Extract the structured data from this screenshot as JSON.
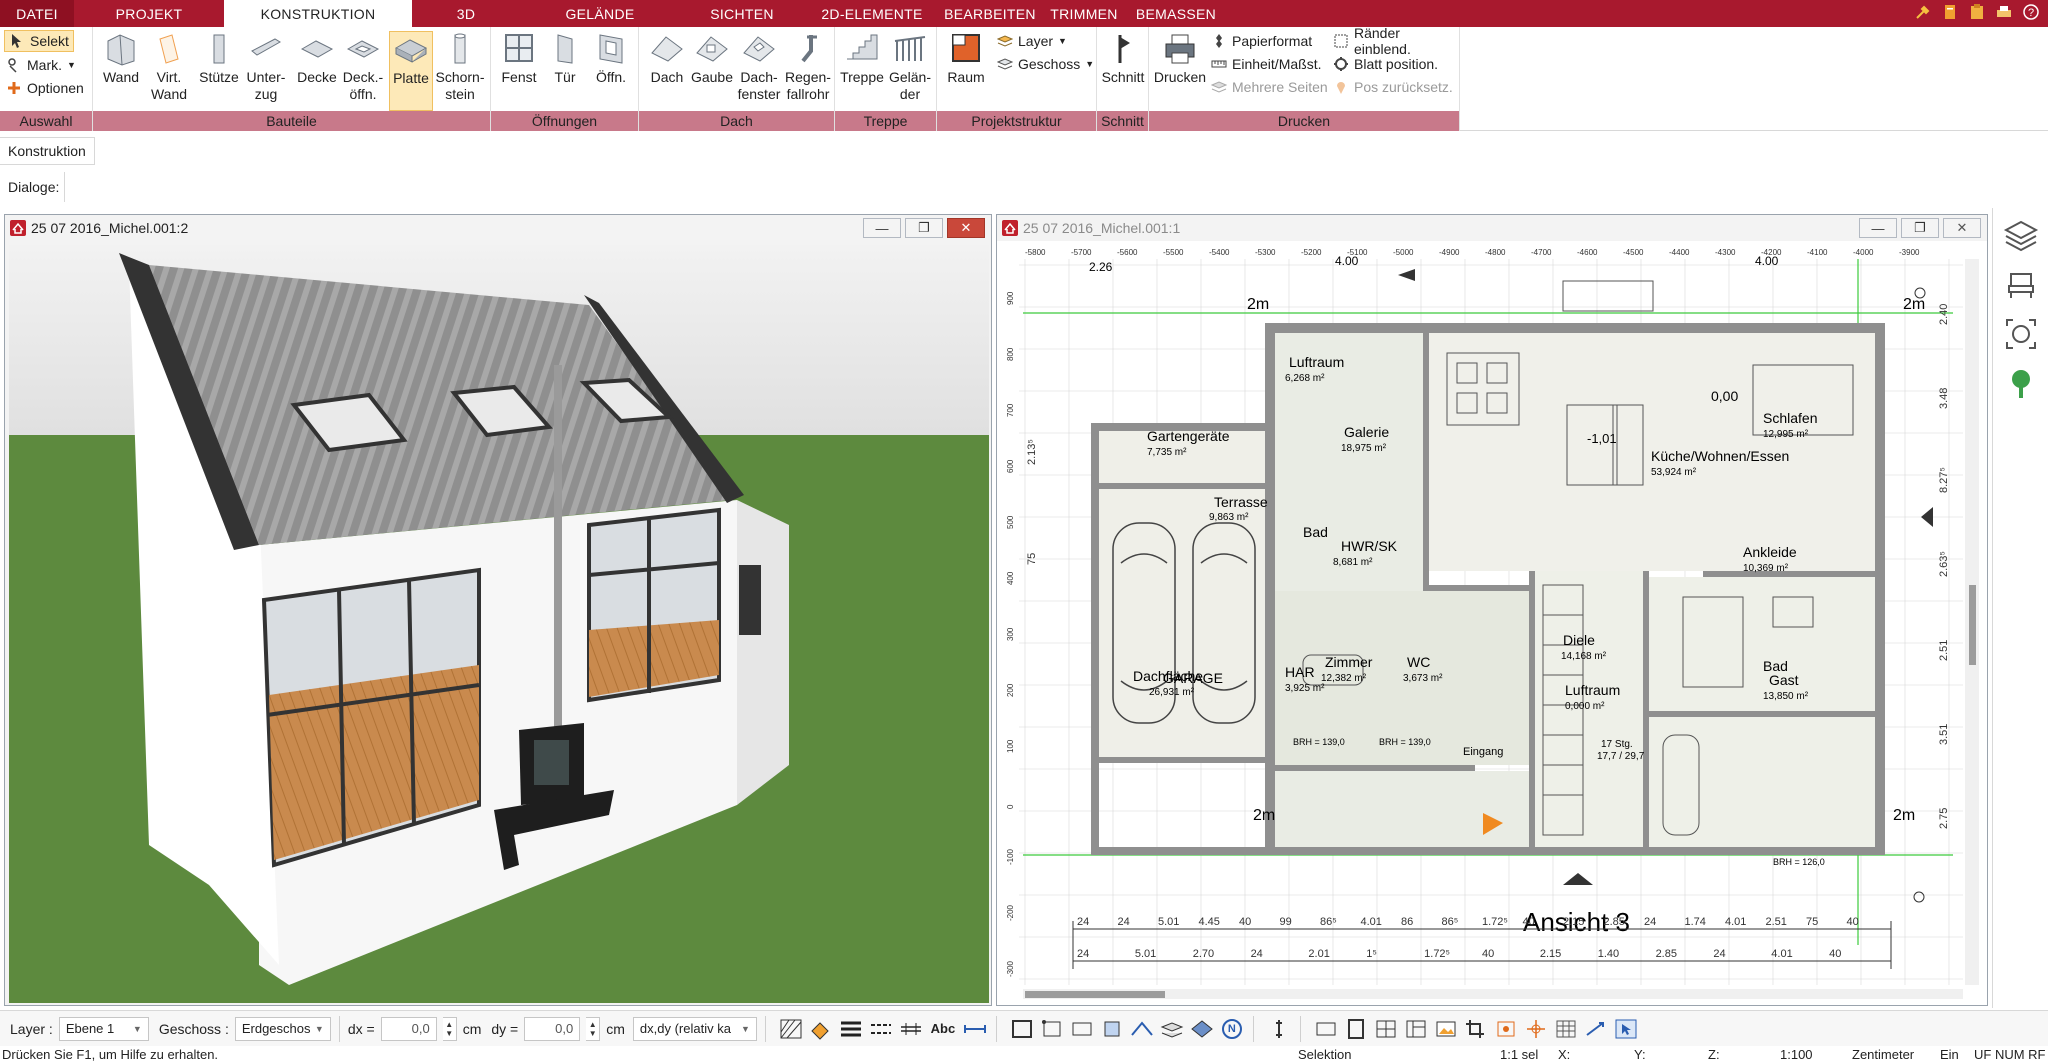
{
  "tabs": [
    {
      "label": "DATEI"
    },
    {
      "label": "PROJEKT"
    },
    {
      "label": "KONSTRUKTION"
    },
    {
      "label": "3D"
    },
    {
      "label": "GELÄNDE"
    },
    {
      "label": "SICHTEN"
    },
    {
      "label": "2D-ELEMENTE"
    },
    {
      "label": "BEARBEITEN"
    },
    {
      "label": "TRIMMEN"
    },
    {
      "label": "BEMASSEN"
    }
  ],
  "ribbon": {
    "auswahl": {
      "label": "Auswahl",
      "selekt": "Selekt",
      "mark": "Mark.",
      "optionen": "Optionen"
    },
    "bauteile": {
      "label": "Bauteile",
      "wand": "Wand",
      "virt_wand_1": "Virt.",
      "virt_wand_2": "Wand",
      "stuetze": "Stütze",
      "unterzug_1": "Unter-",
      "unterzug_2": "zug",
      "decke": "Decke",
      "deck_oeffn_1": "Deck.-",
      "deck_oeffn_2": "öffn.",
      "platte": "Platte",
      "schornstein_1": "Schorn-",
      "schornstein_2": "stein"
    },
    "oeffnungen": {
      "label": "Öffnungen",
      "fenst": "Fenst",
      "tuer": "Tür",
      "oeffn": "Öffn."
    },
    "dach": {
      "label": "Dach",
      "dach": "Dach",
      "gaube": "Gaube",
      "dachfenster_1": "Dach-",
      "dachfenster_2": "fenster",
      "regenfallrohr_1": "Regen-",
      "regenfallrohr_2": "fallrohr"
    },
    "treppe": {
      "label": "Treppe",
      "treppe": "Treppe",
      "gelaender_1": "Gelän-",
      "gelaender_2": "der"
    },
    "projektstruktur": {
      "label": "Projektstruktur",
      "raum": "Raum",
      "layer": "Layer",
      "geschoss": "Geschoss"
    },
    "schnitt": {
      "label": "Schnitt",
      "schnitt": "Schnitt"
    },
    "drucken": {
      "label": "Drucken",
      "drucken": "Drucken",
      "papierformat": "Papierformat",
      "einheit": "Einheit/Maßst.",
      "mehrere_seiten": "Mehrere Seiten",
      "raender": "Ränder einblend.",
      "blatt_position": "Blatt position.",
      "pos_zurueck": "Pos zurücksetz."
    }
  },
  "subtab": "Konstruktion",
  "dialog_label": "Dialoge:",
  "windows": {
    "view3d_title": "25 07 2016_Michel.001:2",
    "plan_title": "25 07 2016_Michel.001:1"
  },
  "plan": {
    "rooms": [
      {
        "name": "Luftraum",
        "area": "6,268 m²"
      },
      {
        "name": "Galerie",
        "area": "18,975 m²"
      },
      {
        "name": "Gartengeräte",
        "area": "7,735 m²"
      },
      {
        "name": "Terrasse",
        "area": "9,863 m²"
      },
      {
        "name": "Schlafen",
        "area": "12,995 m²"
      },
      {
        "name": "Küche/Wohnen/Essen",
        "area": "53,924 m²"
      },
      {
        "name": "Bad",
        "area": ""
      },
      {
        "name": "HWR/SK",
        "area": "8,681 m²"
      },
      {
        "name": "Ankleide",
        "area": "10,369 m²"
      },
      {
        "name": "Diele",
        "area": "14,168 m²"
      },
      {
        "name": "HAR",
        "area": "3,925 m²"
      },
      {
        "name": "Zimmer",
        "area": "12,382 m²"
      },
      {
        "name": "WC",
        "area": "3,673 m²"
      },
      {
        "name": "Bad",
        "area": "13,850 m²"
      },
      {
        "name": "Gast",
        "area": ""
      },
      {
        "name": "Dachfläche",
        "area": "26,931 m²"
      },
      {
        "name": "GARAGE",
        "area": ""
      },
      {
        "name": "Luftraum",
        "area": "0,000 m²"
      },
      {
        "name": "Eingang",
        "area": ""
      }
    ],
    "labels": {
      "ansicht": "Ansicht 3",
      "two_m_1": "2m",
      "two_m_2": "2m",
      "two_m_3": "2m",
      "two_m_4": "2m",
      "zero": "0,00",
      "minus_one": "-1,01",
      "brh_bottom": "BRH = 126,0",
      "stg": "17 Stg.",
      "stg_val": "17,7 / 29,7",
      "dim_226": "2.26",
      "dim_400a": "4.00",
      "dim_400b": "4.00",
      "brh_139a": "BRH = 139,0",
      "brh_139b": "BRH = 139,0"
    },
    "ruler_top": [
      "-5800",
      "-5700",
      "-5600",
      "-5500",
      "-5400",
      "-5300",
      "-5200",
      "-5100",
      "-5000",
      "-4900",
      "-4800",
      "-4700",
      "-4600",
      "-4500",
      "-4400",
      "-4300",
      "-4200",
      "-4100",
      "-4000",
      "-3900"
    ],
    "ruler_left": [
      "900",
      "800",
      "700",
      "600",
      "500",
      "400",
      "300",
      "200",
      "100",
      "0",
      "-100",
      "-200",
      "-300"
    ],
    "dim_row1": [
      "24",
      "24",
      "5.01",
      "4.45",
      "40",
      "99",
      "86⁵",
      "4.01",
      "86",
      "86⁵",
      "1.72⁵",
      "40",
      "2.15",
      "2.85",
      "24",
      "1.74",
      "4.01",
      "2.51",
      "75",
      "40"
    ],
    "dim_row2": [
      "24",
      "5.01",
      "2.70",
      "24",
      "2.01",
      "1⁵",
      "1.72⁵",
      "40",
      "2.15",
      "1.40",
      "2.85",
      "24",
      "4.01",
      "40"
    ],
    "dim_right": [
      "2.40",
      "3.48",
      "8.27⁵",
      "2.63⁵",
      "2.51",
      "3.51",
      "2.75"
    ],
    "dim_left": [
      "2.13⁵",
      "75"
    ]
  },
  "bottombar": {
    "layer_label": "Layer :",
    "layer_value": "Ebene 1",
    "geschoss_label": "Geschoss :",
    "geschoss_value": "Erdgeschos",
    "dx_label": "dx =",
    "dx_value": "0,0",
    "dx_unit": "cm",
    "dy_label": "dy =",
    "dy_value": "0,0",
    "dy_unit": "cm",
    "mode_value": "dx,dy (relativ ka",
    "abc": "Abc",
    "n_btn": "N"
  },
  "statusbar": {
    "help": "Drücken Sie F1, um Hilfe zu erhalten.",
    "selektion": "Selektion",
    "sel": "1:1 sel",
    "x": "X:",
    "y": "Y:",
    "z": "Z:",
    "scale": "1:100",
    "unit": "Zentimeter",
    "ein": "Ein",
    "flags": "UF NUM RF"
  },
  "colors": {
    "tabbar": "#a8192e",
    "group_label": "#c8798a",
    "grass": "#5d8a3e",
    "sky": "#ececec",
    "roof": "#8c8c8c",
    "floor_wood": "#c98a4e",
    "plan_wall": "#8f8f8f",
    "grid_green": "#3ccb3c",
    "accent_orange": "#f08a20"
  }
}
